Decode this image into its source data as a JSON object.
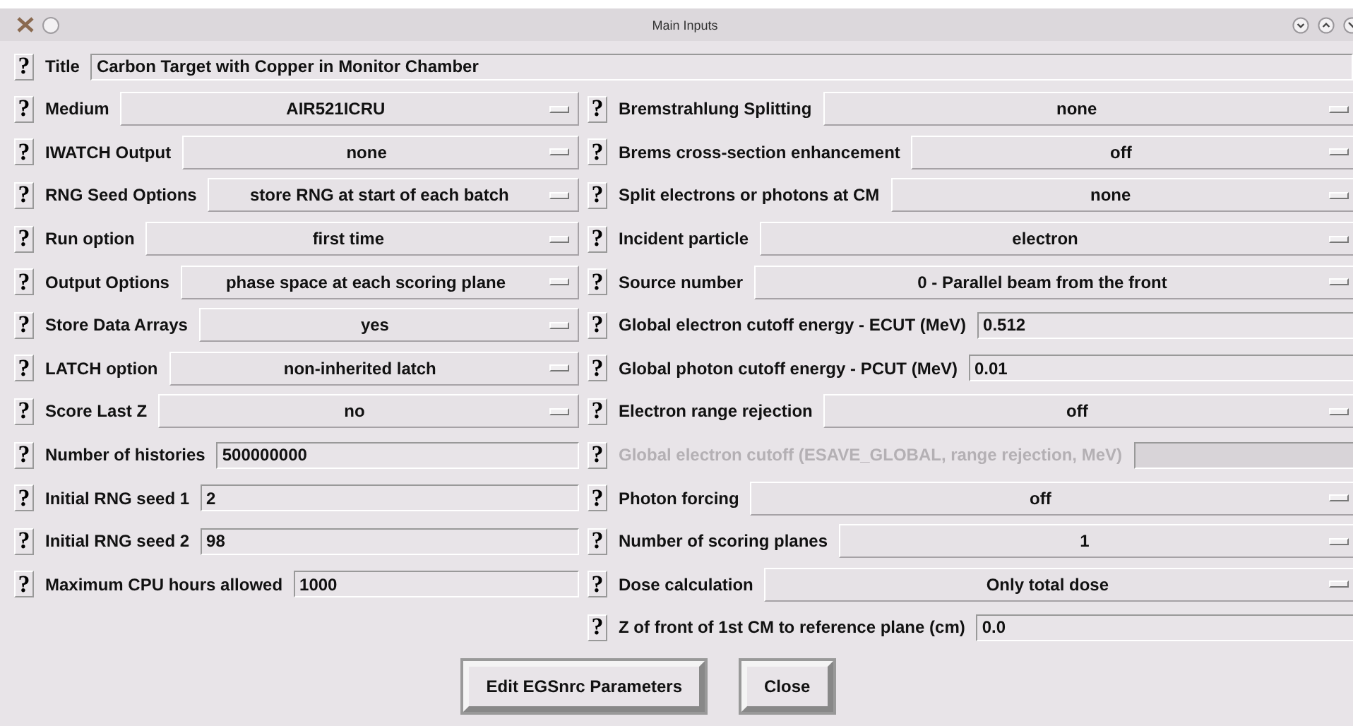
{
  "window": {
    "title": "Main Inputs"
  },
  "title_row": {
    "help": "?",
    "label": "Title",
    "value": "Carbon Target with Copper in Monitor Chamber"
  },
  "left": [
    {
      "kind": "menu",
      "help": "?",
      "label": "Medium",
      "value": "AIR521ICRU"
    },
    {
      "kind": "menu",
      "help": "?",
      "label": "IWATCH Output",
      "value": "none"
    },
    {
      "kind": "menu",
      "help": "?",
      "label": "RNG Seed Options",
      "value": "store RNG at start of each batch"
    },
    {
      "kind": "menu",
      "help": "?",
      "label": "Run option",
      "value": "first time"
    },
    {
      "kind": "menu",
      "help": "?",
      "label": "Output Options",
      "value": "phase space at each scoring plane"
    },
    {
      "kind": "menu",
      "help": "?",
      "label": "Store Data Arrays",
      "value": "yes"
    },
    {
      "kind": "menu",
      "help": "?",
      "label": "LATCH option",
      "value": "non-inherited latch"
    },
    {
      "kind": "menu",
      "help": "?",
      "label": "Score Last Z",
      "value": "no"
    },
    {
      "kind": "entry",
      "help": "?",
      "label": "Number of histories",
      "value": "500000000"
    },
    {
      "kind": "entry",
      "help": "?",
      "label": "Initial RNG seed 1",
      "value": "2"
    },
    {
      "kind": "entry",
      "help": "?",
      "label": "Initial RNG seed 2",
      "value": "98"
    },
    {
      "kind": "entry",
      "help": "?",
      "label": "Maximum CPU hours allowed",
      "value": "1000"
    }
  ],
  "right": [
    {
      "kind": "menu",
      "help": "?",
      "label": "Bremstrahlung Splitting",
      "value": "none",
      "disabled": false
    },
    {
      "kind": "menu",
      "help": "?",
      "label": "Brems cross-section enhancement",
      "value": "off",
      "disabled": false
    },
    {
      "kind": "menu",
      "help": "?",
      "label": "Split electrons or photons at CM",
      "value": "none",
      "disabled": false
    },
    {
      "kind": "menu",
      "help": "?",
      "label": "Incident particle",
      "value": "electron",
      "disabled": false
    },
    {
      "kind": "menu",
      "help": "?",
      "label": "Source number",
      "value": "0 - Parallel beam from the front",
      "disabled": false
    },
    {
      "kind": "entry",
      "help": "?",
      "label": "Global electron cutoff energy - ECUT (MeV)",
      "value": "0.512",
      "disabled": false
    },
    {
      "kind": "entry",
      "help": "?",
      "label": "Global photon cutoff energy - PCUT (MeV)",
      "value": "0.01",
      "disabled": false
    },
    {
      "kind": "menu",
      "help": "?",
      "label": "Electron range rejection",
      "value": "off",
      "disabled": false
    },
    {
      "kind": "entry",
      "help": "?",
      "label": "Global electron cutoff (ESAVE_GLOBAL, range rejection, MeV)",
      "disabled": true
    },
    {
      "kind": "menu",
      "help": "?",
      "label": "Photon forcing",
      "value": "off",
      "disabled": false
    },
    {
      "kind": "menu",
      "help": "?",
      "label": "Number of scoring planes",
      "value": "1",
      "disabled": false
    },
    {
      "kind": "menu",
      "help": "?",
      "label": "Dose calculation",
      "value": "Only total dose",
      "disabled": false
    },
    {
      "kind": "entry",
      "help": "?",
      "label": "Z of front of 1st CM to reference plane (cm)",
      "value": "0.0",
      "disabled": false
    }
  ],
  "buttons": [
    "Edit EGSnrc Parameters",
    "Close"
  ]
}
